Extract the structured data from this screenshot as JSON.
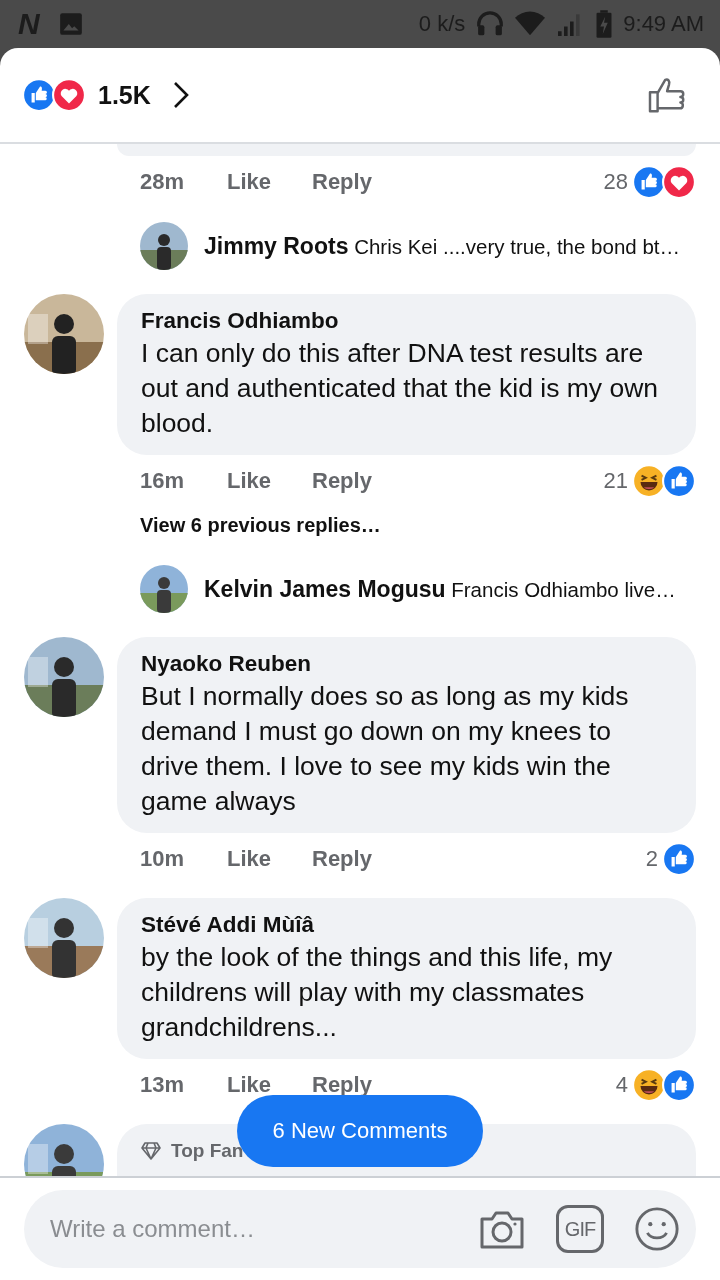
{
  "status_bar": {
    "app_badge": "N",
    "speed": "0 k/s",
    "time": "9:49 AM"
  },
  "header": {
    "reactions": [
      {
        "kind": "like"
      },
      {
        "kind": "love"
      }
    ],
    "count": "1.5K"
  },
  "items": [
    {
      "kind": "meta",
      "time": "28m",
      "like": "Like",
      "reply": "Reply",
      "count": "28",
      "reactions": [
        {
          "kind": "like"
        },
        {
          "kind": "love"
        }
      ]
    },
    {
      "kind": "reply_preview",
      "name": "Jimmy Roots",
      "text": "Chris Kei ....very true, the bond bt…"
    },
    {
      "kind": "comment",
      "name": "Francis Odhiambo",
      "text": "I can only do this after DNA test results are out and authenticated that the kid is my own blood."
    },
    {
      "kind": "meta",
      "time": "16m",
      "like": "Like",
      "reply": "Reply",
      "count": "21",
      "reactions": [
        {
          "kind": "haha"
        },
        {
          "kind": "like"
        }
      ]
    },
    {
      "kind": "view_replies",
      "text": "View 6 previous replies…"
    },
    {
      "kind": "reply_preview",
      "name": "Kelvin James Mogusu",
      "text": "Francis Odhiambo live…"
    },
    {
      "kind": "comment",
      "name": "Nyaoko Reuben",
      "text": "But I normally does so as long as my kids demand I must go down on my knees to drive them. I love to see my kids win the game always"
    },
    {
      "kind": "meta",
      "time": "10m",
      "like": "Like",
      "reply": "Reply",
      "count": "2",
      "reactions": [
        {
          "kind": "like"
        }
      ]
    },
    {
      "kind": "comment",
      "name": "Stévé Addi Mùîâ",
      "text": "by the look of the things and this life, my childrens will play with my classmates grandchildrens..."
    },
    {
      "kind": "meta",
      "time": "13m",
      "like": "Like",
      "reply": "Reply",
      "count": "4",
      "reactions": [
        {
          "kind": "haha"
        },
        {
          "kind": "like"
        }
      ]
    },
    {
      "kind": "comment_partial",
      "badge": "Top Fan"
    }
  ],
  "new_comments": "6 New Comments",
  "composer": {
    "placeholder": "Write a comment…",
    "gif": "GIF"
  }
}
